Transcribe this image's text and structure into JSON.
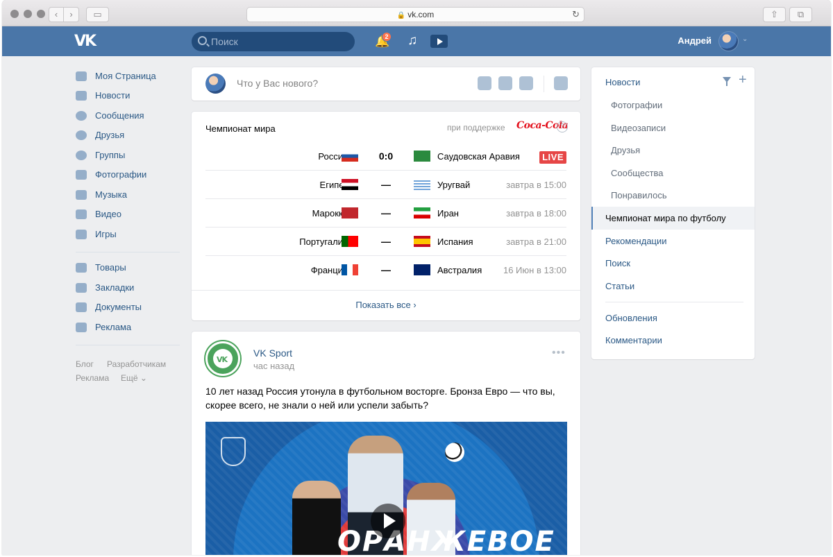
{
  "browser": {
    "url": "vk.com",
    "lock_icon": "lock-icon",
    "reload_icon": "reload-icon"
  },
  "topbar": {
    "search_placeholder": "Поиск",
    "notifications_count": "2",
    "user_name": "Андрей",
    "brand_color": "#4a76a8"
  },
  "sidebar": {
    "items": [
      {
        "label": "Моя Страница",
        "icon": "home-icon"
      },
      {
        "label": "Новости",
        "icon": "news-icon"
      },
      {
        "label": "Сообщения",
        "icon": "messages-icon"
      },
      {
        "label": "Друзья",
        "icon": "friends-icon"
      },
      {
        "label": "Группы",
        "icon": "groups-icon"
      },
      {
        "label": "Фотографии",
        "icon": "camera-icon"
      },
      {
        "label": "Музыка",
        "icon": "music-icon"
      },
      {
        "label": "Видео",
        "icon": "video-icon"
      },
      {
        "label": "Игры",
        "icon": "games-icon"
      }
    ],
    "items2": [
      {
        "label": "Товары",
        "icon": "bag-icon"
      },
      {
        "label": "Закладки",
        "icon": "star-icon"
      },
      {
        "label": "Документы",
        "icon": "document-icon"
      },
      {
        "label": "Реклама",
        "icon": "megaphone-icon"
      }
    ],
    "footer": [
      "Блог",
      "Разработчикам",
      "Реклама",
      "Ещё ⌄"
    ]
  },
  "composer": {
    "placeholder": "Что у Вас нового?"
  },
  "worldcup": {
    "title": "Чемпионат мира",
    "sponsor_prefix": "при поддержке",
    "sponsor": "Coca-Cola",
    "help": "?",
    "matches": [
      {
        "home": "Россия",
        "home_flag": "russia",
        "score": "0:0",
        "away": "Саудовская Аравия",
        "away_flag": "saudi",
        "status": "LIVE"
      },
      {
        "home": "Египет",
        "home_flag": "egypt",
        "score": "—",
        "away": "Уругвай",
        "away_flag": "uruguay",
        "time": "завтра в 15:00"
      },
      {
        "home": "Марокко",
        "home_flag": "morocco",
        "score": "—",
        "away": "Иран",
        "away_flag": "iran",
        "time": "завтра в 18:00"
      },
      {
        "home": "Португалия",
        "home_flag": "portugal",
        "score": "—",
        "away": "Испания",
        "away_flag": "spain",
        "time": "завтра в 21:00"
      },
      {
        "home": "Франция",
        "home_flag": "france",
        "score": "—",
        "away": "Австралия",
        "away_flag": "australia",
        "time": "16 Июн в 13:00"
      }
    ],
    "show_all": "Показать все ›",
    "live_color": "#e64646"
  },
  "post": {
    "author": "VK Sport",
    "time": "час назад",
    "text": "10 лет назад Россия утонула в футбольном восторге. Бронза Евро — что вы, скорее всего, не знали о ней или успели забыть?",
    "image_title": "ОРАНЖЕВОЕ",
    "more": "•••"
  },
  "right_menu": {
    "items": [
      {
        "label": "Новости",
        "type": "main"
      },
      {
        "label": "Фотографии",
        "type": "sub"
      },
      {
        "label": "Видеозаписи",
        "type": "sub"
      },
      {
        "label": "Друзья",
        "type": "sub"
      },
      {
        "label": "Сообщества",
        "type": "sub"
      },
      {
        "label": "Понравилось",
        "type": "sub"
      },
      {
        "label": "Чемпионат мира по футболу",
        "type": "active"
      },
      {
        "label": "Рекомендации",
        "type": "main"
      },
      {
        "label": "Поиск",
        "type": "main"
      },
      {
        "label": "Статьи",
        "type": "main"
      }
    ],
    "items2": [
      {
        "label": "Обновления"
      },
      {
        "label": "Комментарии"
      }
    ]
  }
}
